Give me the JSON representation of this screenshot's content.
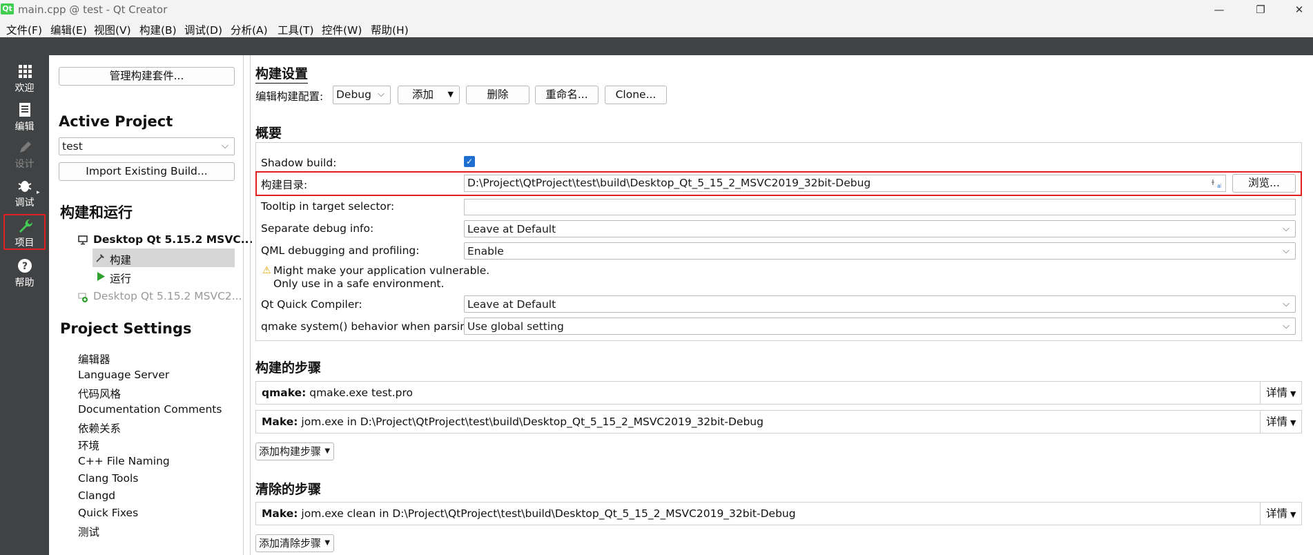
{
  "window": {
    "logo_text": "Qt",
    "title": "main.cpp @ test - Qt Creator",
    "minimize": "—",
    "restore": "❐",
    "close": "✕"
  },
  "menu": [
    "文件(F)",
    "编辑(E)",
    "视图(V)",
    "构建(B)",
    "调试(D)",
    "分析(A)",
    "工具(T)",
    "控件(W)",
    "帮助(H)"
  ],
  "modes": [
    {
      "label": "欢迎",
      "icon": "grid-icon"
    },
    {
      "label": "编辑",
      "icon": "document-icon"
    },
    {
      "label": "设计",
      "icon": "pencil-icon"
    },
    {
      "label": "调试",
      "icon": "bug-icon"
    },
    {
      "label": "项目",
      "icon": "wrench-icon"
    },
    {
      "label": "帮助",
      "icon": "help-icon"
    }
  ],
  "left": {
    "manage_kits": "管理构建套件...",
    "active_project_heading": "Active Project",
    "project_combo": "test",
    "import_build": "Import Existing Build...",
    "build_run_heading": "构建和运行",
    "kit_name": "Desktop Qt 5.15.2 MSVC...",
    "build_item": "构建",
    "run_item": "运行",
    "kit_disabled": "Desktop Qt 5.15.2 MSVC2...",
    "project_settings_heading": "Project Settings",
    "project_settings": [
      "编辑器",
      "Language Server",
      "代码风格",
      "Documentation Comments",
      "依赖关系",
      "环境",
      "C++ File Naming",
      "Clang Tools",
      "Clangd",
      "Quick Fixes",
      "测试"
    ]
  },
  "main": {
    "build_settings_title": "构建设置",
    "edit_config_label": "编辑构建配置:",
    "config_value": "Debug",
    "add_label": "添加",
    "delete_label": "删除",
    "rename_label": "重命名...",
    "clone_label": "Clone...",
    "overview_title": "概要",
    "shadow_build_label": "Shadow build:",
    "build_dir_label": "构建目录:",
    "build_dir_value": "D:\\Project\\QtProject\\test\\build\\Desktop_Qt_5_15_2_MSVC2019_32bit-Debug",
    "browse_label": "浏览...",
    "tooltip_label": "Tooltip in target selector:",
    "tooltip_value": "",
    "separate_debug_label": "Separate debug info:",
    "separate_debug_value": "Leave at Default",
    "qml_debug_label": "QML debugging and profiling:",
    "qml_debug_value": "Enable",
    "warning_line1": "Might make your application vulnerable.",
    "warning_line2": "Only use in a safe environment.",
    "quick_compiler_label": "Qt Quick Compiler:",
    "quick_compiler_value": "Leave at Default",
    "qmake_system_label": "qmake system() behavior when parsing:",
    "qmake_system_value": "Use global setting",
    "build_steps_title": "构建的步骤",
    "step1_bold": "qmake:",
    "step1_text": " qmake.exe test.pro",
    "step2_bold": "Make:",
    "step2_text": " jom.exe in D:\\Project\\QtProject\\test\\build\\Desktop_Qt_5_15_2_MSVC2019_32bit-Debug",
    "detail_label": "详情",
    "add_build_step": "添加构建步骤",
    "clean_steps_title": "清除的步骤",
    "clean_bold": "Make:",
    "clean_text": " jom.exe clean in D:\\Project\\QtProject\\test\\build\\Desktop_Qt_5_15_2_MSVC2019_32bit-Debug",
    "add_clean_step": "添加清除步骤"
  },
  "colors": {
    "accent": "#1e6fd0",
    "highlight": "#e02020",
    "dark": "#404244",
    "qt_green": "#41cd52"
  }
}
